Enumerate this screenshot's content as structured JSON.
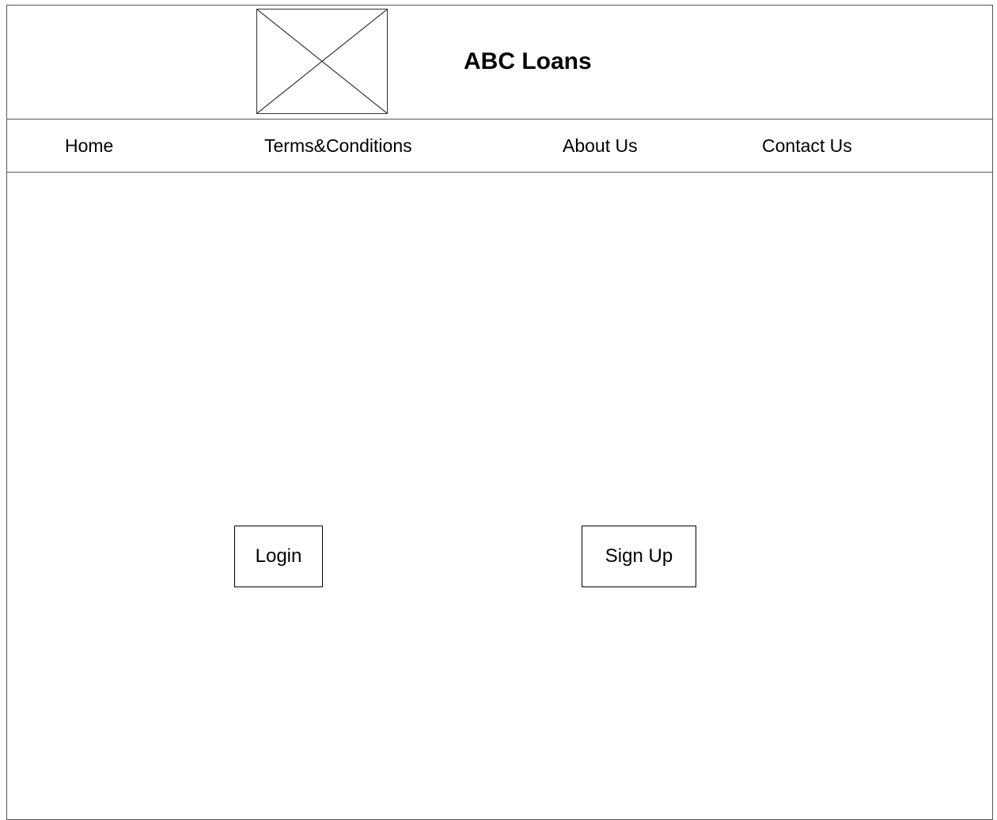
{
  "header": {
    "logo_icon": "image-placeholder-icon",
    "brand": "ABC Loans"
  },
  "nav": {
    "items": [
      {
        "label": "Home"
      },
      {
        "label": "Terms&Conditions"
      },
      {
        "label": "About Us"
      },
      {
        "label": "Contact Us"
      }
    ]
  },
  "main": {
    "login_label": "Login",
    "signup_label": "Sign Up"
  }
}
